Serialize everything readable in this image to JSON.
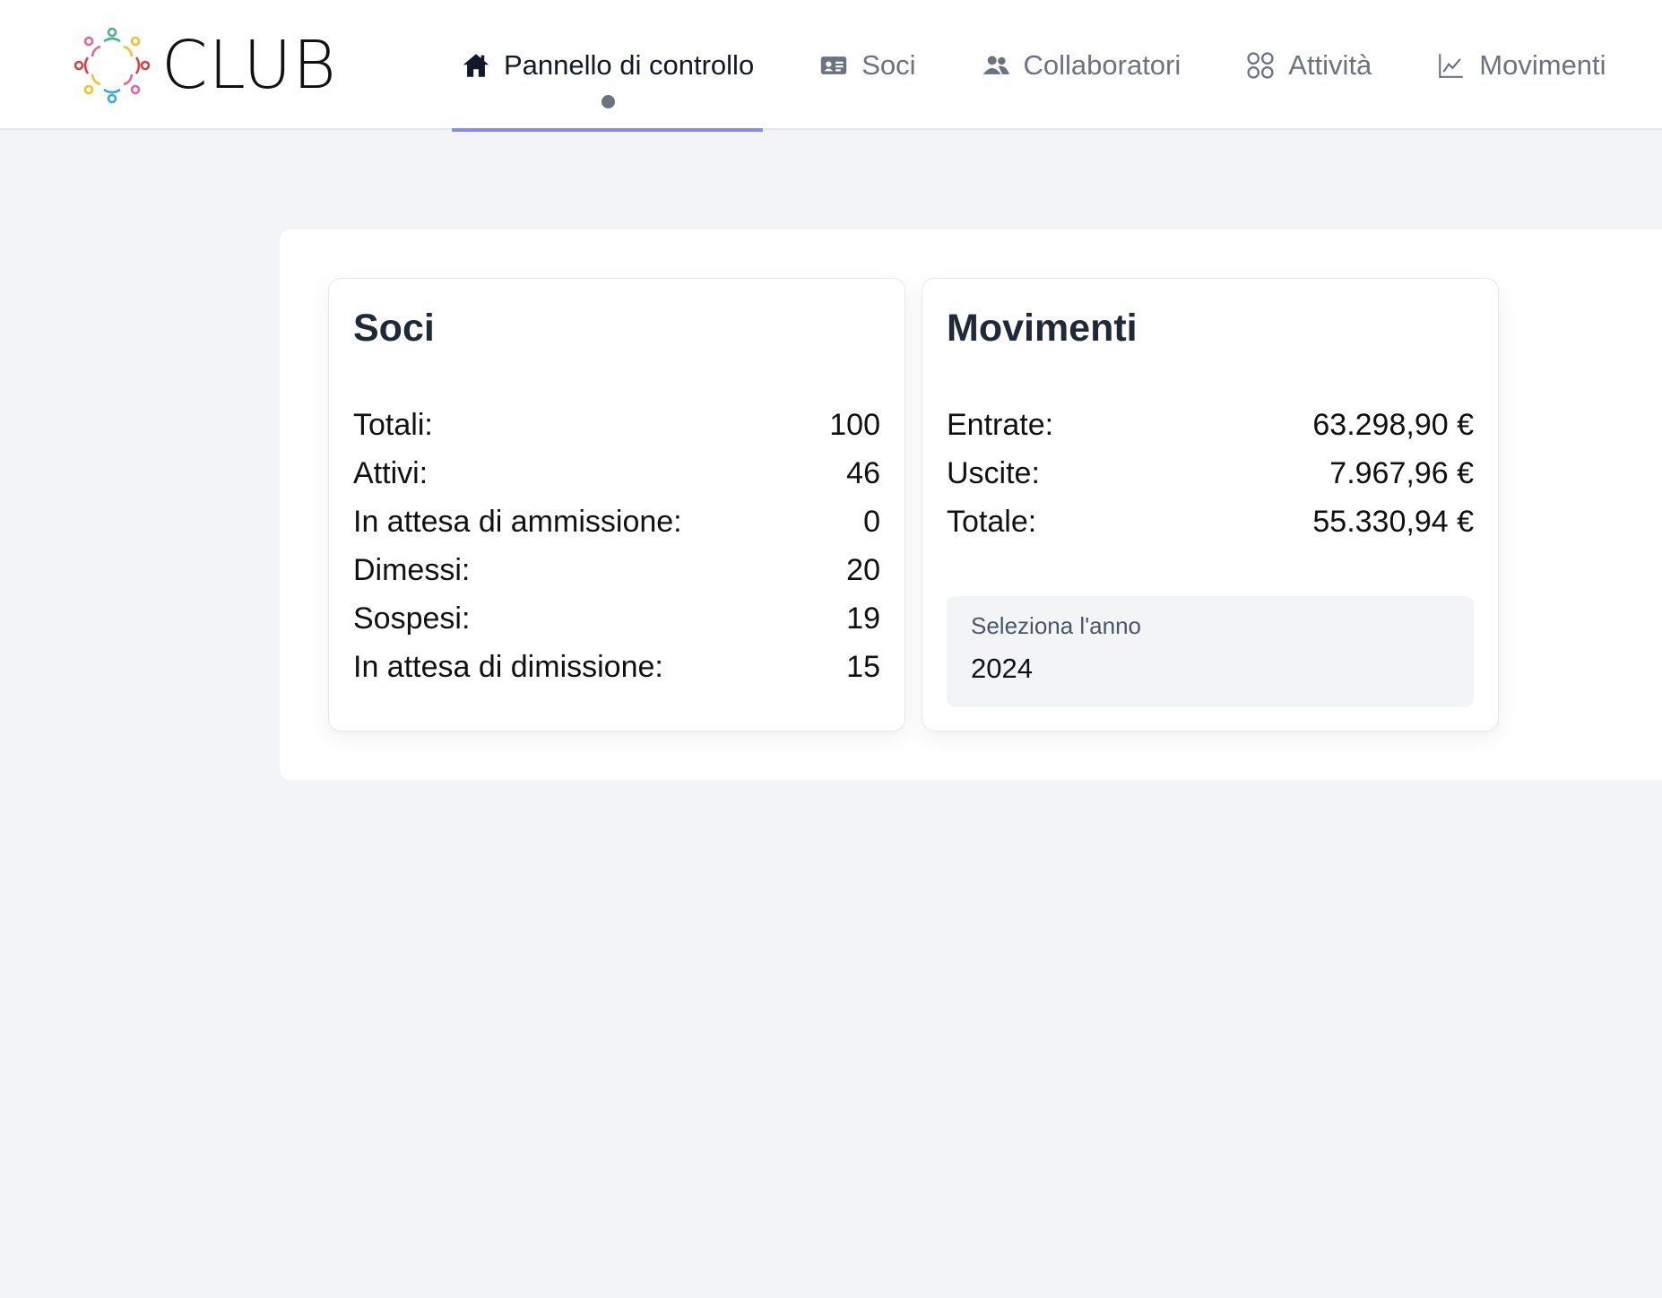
{
  "brand": {
    "name": "CLUB"
  },
  "nav": [
    {
      "label": "Pannello di controllo",
      "icon": "home-icon",
      "active": true
    },
    {
      "label": "Soci",
      "icon": "id-card-icon"
    },
    {
      "label": "Collaboratori",
      "icon": "users-icon"
    },
    {
      "label": "Attività",
      "icon": "grid-icon"
    },
    {
      "label": "Movimenti",
      "icon": "chart-line-icon"
    }
  ],
  "soci": {
    "title": "Soci",
    "rows": [
      {
        "label": "Totali:",
        "value": "100"
      },
      {
        "label": "Attivi:",
        "value": "46"
      },
      {
        "label": "In attesa di ammissione:",
        "value": "0"
      },
      {
        "label": "Dimessi:",
        "value": "20"
      },
      {
        "label": "Sospesi:",
        "value": "19"
      },
      {
        "label": "In attesa di dimissione:",
        "value": "15"
      }
    ]
  },
  "movimenti": {
    "title": "Movimenti",
    "rows": [
      {
        "label": "Entrate:",
        "value": "63.298,90 €"
      },
      {
        "label": "Uscite:",
        "value": "7.967,96 €"
      },
      {
        "label": "Totale:",
        "value": "55.330,94 €"
      }
    ],
    "year_select": {
      "label": "Seleziona l'anno",
      "value": "2024"
    }
  },
  "colors": {
    "accent": "#818cf8",
    "background": "#f3f4f6"
  }
}
